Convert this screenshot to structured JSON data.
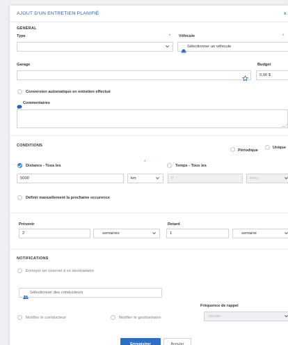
{
  "header": {
    "title": "AJOUT D'UN ENTRETIEN PLANIFIÉ",
    "close_icon": "×"
  },
  "general": {
    "section_title": "GÉNÉRAL",
    "type": {
      "label": "Type",
      "value": ""
    },
    "vehicule": {
      "label": "Véhicule",
      "placeholder": "Sélectionner un véhicule"
    },
    "garage": {
      "label": "Garage",
      "value": ""
    },
    "budget": {
      "label": "Budget",
      "value": "0,00 $"
    },
    "conversion_label": "Conversion automatique en entretien effectué",
    "commentaires_label": "Commentaires",
    "required_mark": "*"
  },
  "conditions": {
    "section_title": "CONDITIONS",
    "periodique_label": "Périodique",
    "unique_label": "Unique",
    "distance": {
      "label": "Distance - Tous les",
      "value": "5000",
      "unit": "km"
    },
    "temps": {
      "label": "Temps - Tous les",
      "value": "0",
      "unit": "mois"
    },
    "definir_label": "Définir manuellement la prochaine occurence"
  },
  "alerts": {
    "prevenir": {
      "label": "Prévenir",
      "value": "2",
      "unit": "semaines"
    },
    "retard": {
      "label": "Retard",
      "value": "1",
      "unit": "semaine"
    }
  },
  "notifications": {
    "section_title": "NOTIFICATIONS",
    "email_label": "Envoyer un courriel à ce destinataire",
    "conducteurs_placeholder": "Sélectionner des conducteurs",
    "frequence_label": "Fréquence de rappel",
    "frequence_value": "Jamais",
    "notifier_conducteur": "Notifier le conducteur",
    "notifier_gestionnaire": "Notifier le gestionnaire"
  },
  "footer": {
    "save_label": "Enregistrer",
    "cancel_label": "Annuler"
  },
  "colors": {
    "accent": "#2a62b6",
    "primary_button": "#2d6fc4",
    "radio_checked": "#2a88d8",
    "required": "#d9534f"
  },
  "icons": {
    "vehicle": "car-icon",
    "garage_favorite": "star-icon",
    "comment": "speech-bubble-icon",
    "drivers": "users-icon",
    "dropdown": "chevron-down-icon"
  }
}
